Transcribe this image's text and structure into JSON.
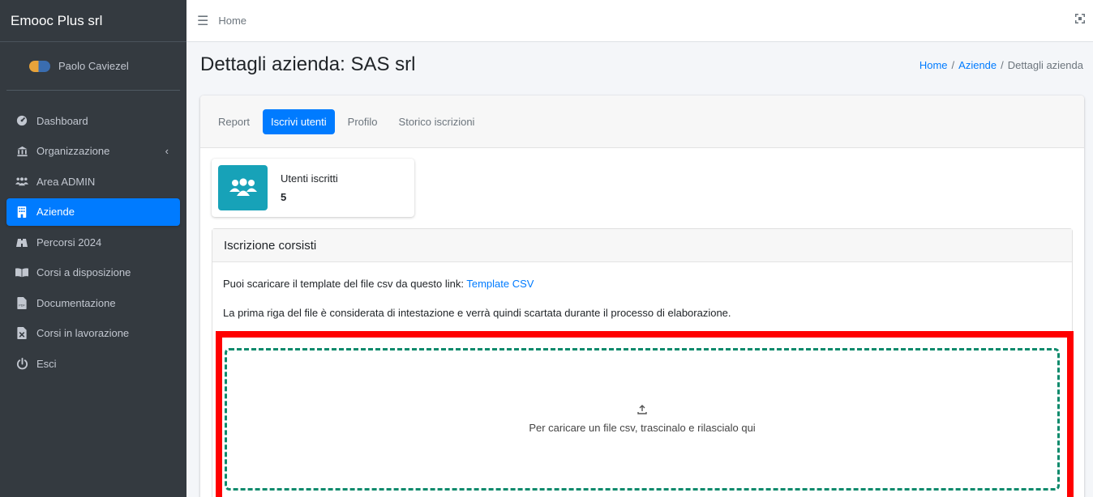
{
  "sidebar": {
    "brand": "Emooc Plus srl",
    "user_name": "Paolo Caviezel",
    "items": [
      {
        "label": "Dashboard",
        "icon": "dashboard-icon"
      },
      {
        "label": "Organizzazione",
        "icon": "university-icon"
      },
      {
        "label": "Area ADMIN",
        "icon": "users-icon"
      },
      {
        "label": "Aziende",
        "icon": "building-icon",
        "active": true
      },
      {
        "label": "Percorsi 2024",
        "icon": "binoculars-icon"
      },
      {
        "label": "Corsi a disposizione",
        "icon": "book-icon"
      },
      {
        "label": "Documentazione",
        "icon": "pdf-file-icon"
      },
      {
        "label": "Corsi in lavorazione",
        "icon": "excel-file-icon"
      },
      {
        "label": "Esci",
        "icon": "power-icon"
      }
    ]
  },
  "topnav": {
    "home": "Home"
  },
  "header": {
    "title": "Dettagli azienda: SAS srl",
    "breadcrumb": [
      "Home",
      "Aziende",
      "Dettagli azienda"
    ]
  },
  "tabs": [
    "Report",
    "Iscrivi utenti",
    "Profilo",
    "Storico iscrizioni"
  ],
  "info_box": {
    "label": "Utenti iscritti",
    "number": "5"
  },
  "upload": {
    "title": "Iscrizione corsisti",
    "template_text": "Puoi scaricare il template del file csv da questo link:",
    "template_link": "Template CSV",
    "note": "La prima riga del file è considerata di intestazione e verrà quindi scartata durante il processo di elaborazione.",
    "dropzone_text": "Per caricare un file csv, trascinalo e rilascialo qui"
  },
  "colors": {
    "accent": "#007bff",
    "sidebar": "#343a40",
    "info": "#17a2b8",
    "highlight": "#ff0000",
    "dropzone_border": "#0e8a6c"
  }
}
